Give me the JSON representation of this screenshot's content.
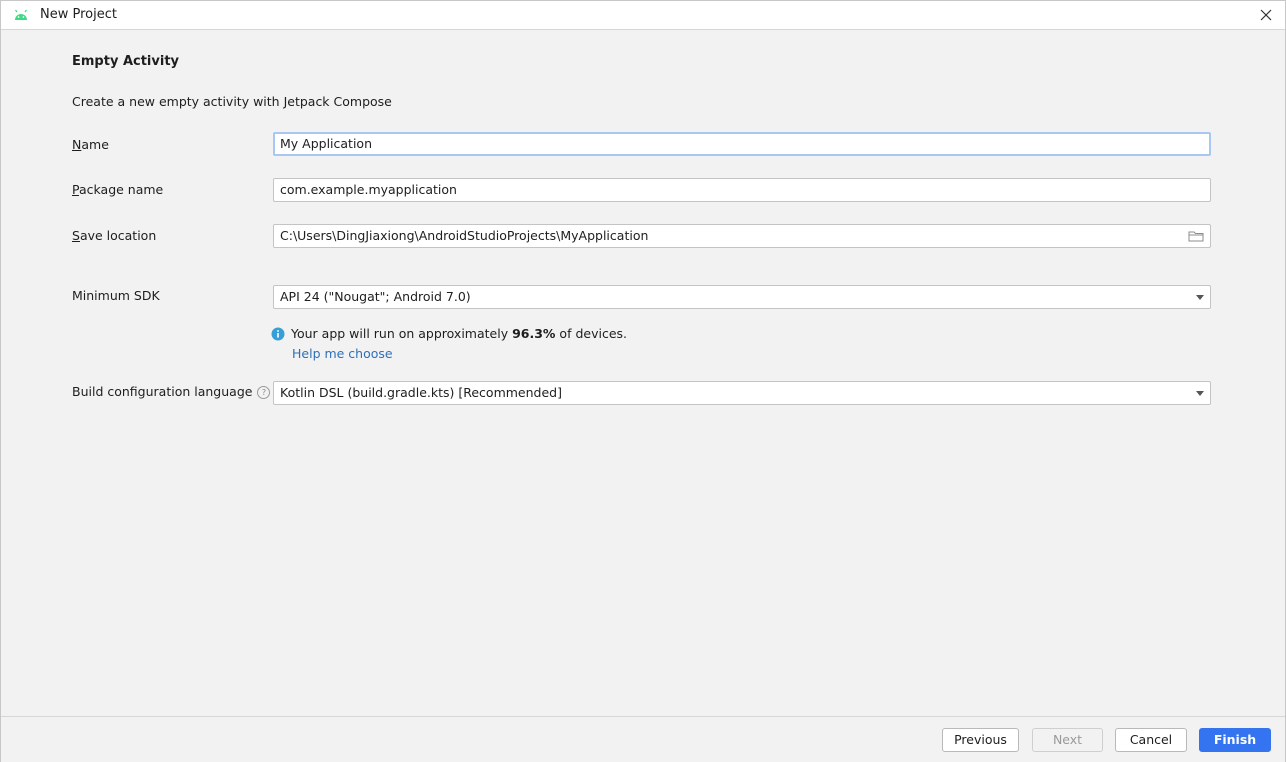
{
  "window": {
    "title": "New Project"
  },
  "page": {
    "heading": "Empty Activity",
    "description": "Create a new empty activity with Jetpack Compose"
  },
  "form": {
    "name": {
      "mnemonic": "N",
      "rest": "ame",
      "value": "My Application"
    },
    "package": {
      "mnemonic": "P",
      "rest": "ackage name",
      "value": "com.example.myapplication"
    },
    "save_location": {
      "mnemonic": "S",
      "rest": "ave location",
      "value": "C:\\Users\\DingJiaxiong\\AndroidStudioProjects\\MyApplication"
    },
    "min_sdk": {
      "label": "Minimum SDK",
      "value": "API 24 (\"Nougat\"; Android 7.0)"
    },
    "info": {
      "prefix": "Your app will run on approximately ",
      "percent": "96.3%",
      "suffix": " of devices."
    },
    "help_link": "Help me choose",
    "build_lang": {
      "label": "Build configuration language",
      "help_mark": "?",
      "value": "Kotlin DSL (build.gradle.kts) [Recommended]"
    }
  },
  "footer": {
    "previous": "Previous",
    "next": "Next",
    "cancel": "Cancel",
    "finish": "Finish"
  },
  "colors": {
    "accent": "#3574f0",
    "link": "#2e6fb8",
    "info": "#389fd6",
    "android": "#3ddc84"
  },
  "icons": {
    "app": "android-icon",
    "close": "close-icon",
    "folder": "folder-icon",
    "info": "info-icon",
    "dropdown": "chevron-down-icon",
    "help": "question-icon"
  }
}
